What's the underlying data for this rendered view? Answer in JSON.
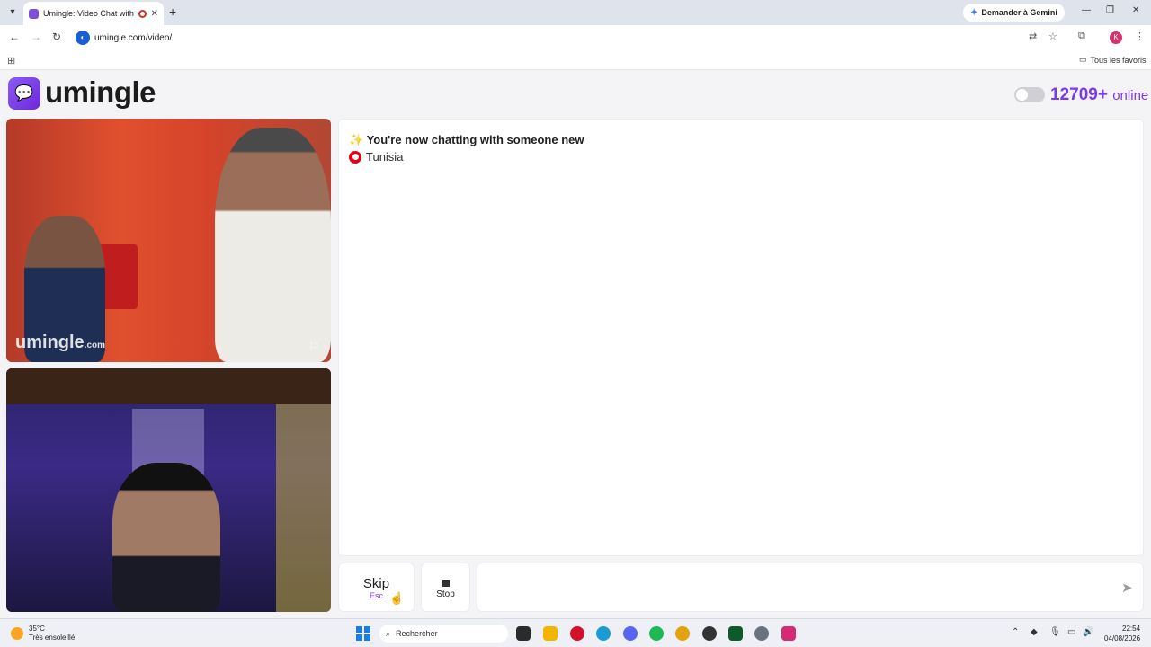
{
  "browser": {
    "tab_title": "Umingle: Video Chat with St",
    "new_tab": "+",
    "gemini_label": "Demander à Gemini",
    "url": "umingle.com/video/",
    "bookmarks_label": "Tous les favoris",
    "profile_initial": "K"
  },
  "site": {
    "logo_text": "umingle",
    "online_count": "12709+",
    "online_word": "online"
  },
  "video": {
    "watermark": "umingle",
    "watermark_suffix": ".com"
  },
  "chat": {
    "status_emoji": "✨",
    "status_message": "You're now chatting with someone new",
    "country": "Tunisia",
    "input_placeholder": ""
  },
  "controls": {
    "skip_label": "Skip",
    "skip_key": "Esc",
    "stop_label": "Stop"
  },
  "taskbar": {
    "temperature": "35°C",
    "weather_desc": "Très ensoleillé",
    "search_placeholder": "Rechercher",
    "time": "22:54",
    "date": "04/08/2026"
  },
  "colors": {
    "accent": "#7c3aed",
    "tunisia_flag": "#e70013"
  }
}
